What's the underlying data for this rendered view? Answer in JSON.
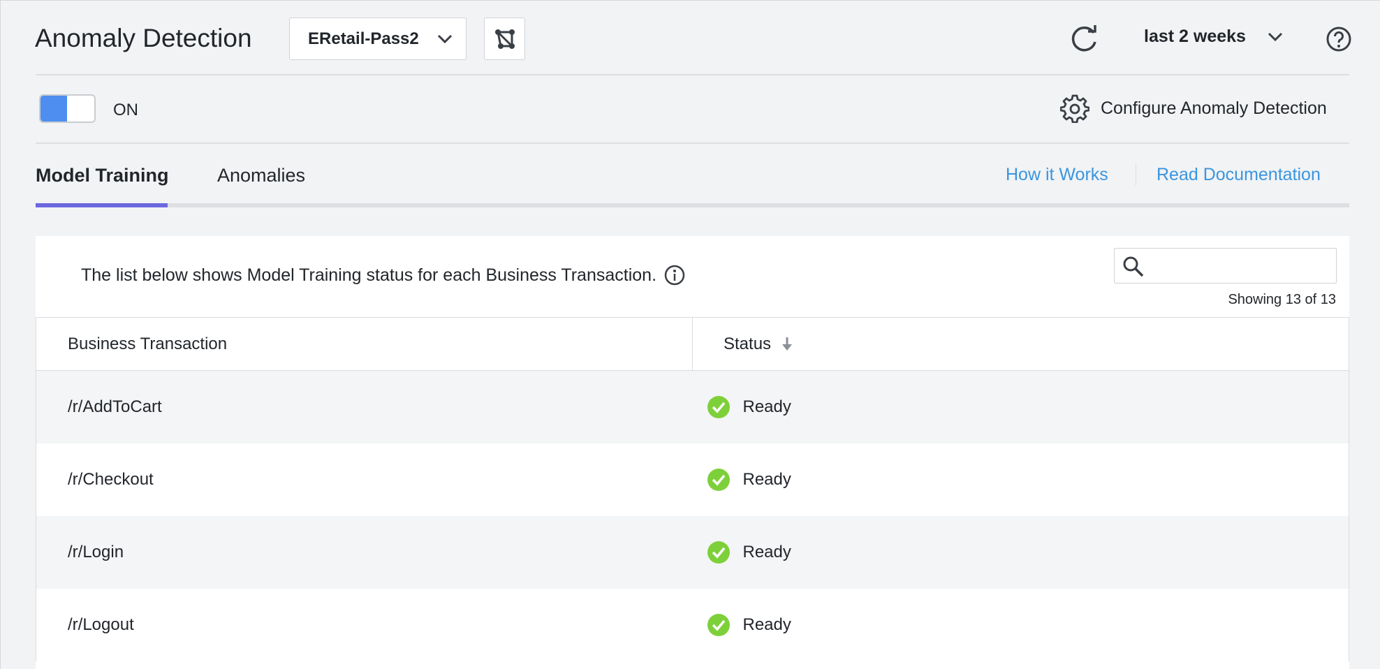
{
  "header": {
    "title": "Anomaly Detection",
    "app_selector": "ERetail-Pass2",
    "time_range": "last 2 weeks"
  },
  "toggle": {
    "state": "ON"
  },
  "configure_label": "Configure Anomaly Detection",
  "tabs": [
    {
      "label": "Model Training",
      "active": true
    },
    {
      "label": "Anomalies",
      "active": false
    }
  ],
  "links": {
    "how_it_works": "How it Works",
    "read_docs": "Read Documentation"
  },
  "panel": {
    "intro": "The list below shows Model Training status for each Business Transaction.",
    "search_value": "",
    "showing": "Showing 13 of 13"
  },
  "table": {
    "columns": [
      "Business Transaction",
      "Status"
    ],
    "rows": [
      {
        "bt": "/r/AddToCart",
        "status": "Ready"
      },
      {
        "bt": "/r/Checkout",
        "status": "Ready"
      },
      {
        "bt": "/r/Login",
        "status": "Ready"
      },
      {
        "bt": "/r/Logout",
        "status": "Ready"
      }
    ]
  },
  "colors": {
    "accent": "#6b68e0",
    "link": "#3a95e0",
    "toggle_on": "#4d8ef0",
    "ready": "#7ed03a"
  }
}
